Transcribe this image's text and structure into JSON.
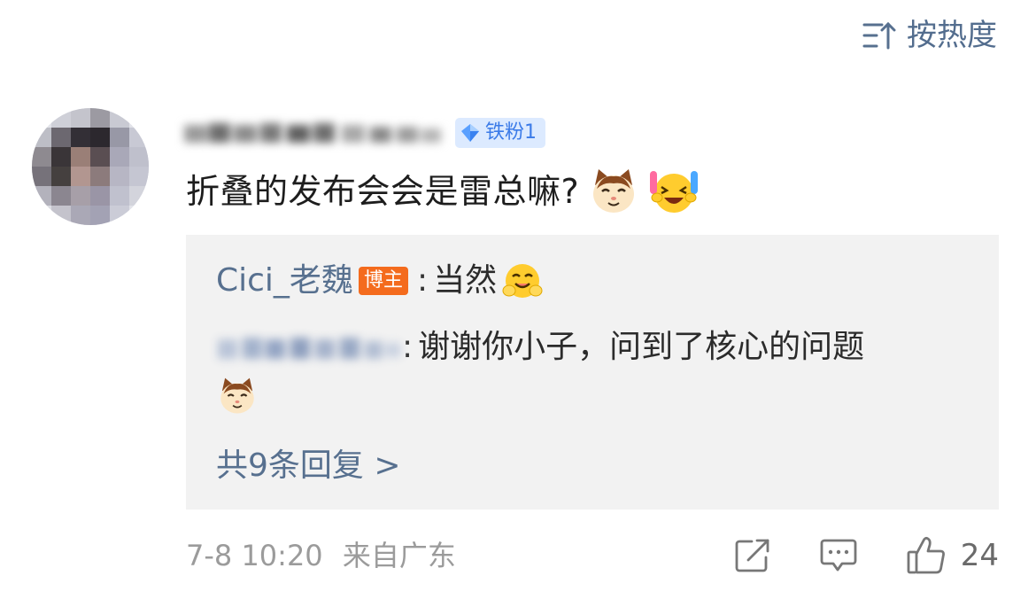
{
  "sort": {
    "label": "按热度",
    "icon": "sort-icon"
  },
  "comment": {
    "fan_badge": "铁粉1",
    "text": "折叠的发布会会是雷总嘛?",
    "emojis": [
      "cat-face-emoji",
      "laughing-cheer-emoji"
    ]
  },
  "replies": [
    {
      "author": "Cici_老魏",
      "author_badge": "博主",
      "separator": ":",
      "text": "当然",
      "emoji": "hug-emoji"
    },
    {
      "separator": ":",
      "text": "谢谢你小子，问到了核心的问题",
      "emoji": "cat-face-emoji"
    }
  ],
  "more_replies": "共9条回复 >",
  "footer": {
    "timestamp": "7-8 10:20",
    "location": "来自广东",
    "like_count": "24",
    "icons": [
      "share-icon",
      "comment-icon",
      "like-icon"
    ]
  },
  "colors": {
    "link": "#57708f",
    "author_badge": "#f46b1d",
    "fan_badge_bg": "#dceaff",
    "reply_bg": "#f2f2f2",
    "meta": "#9b9b9b"
  }
}
